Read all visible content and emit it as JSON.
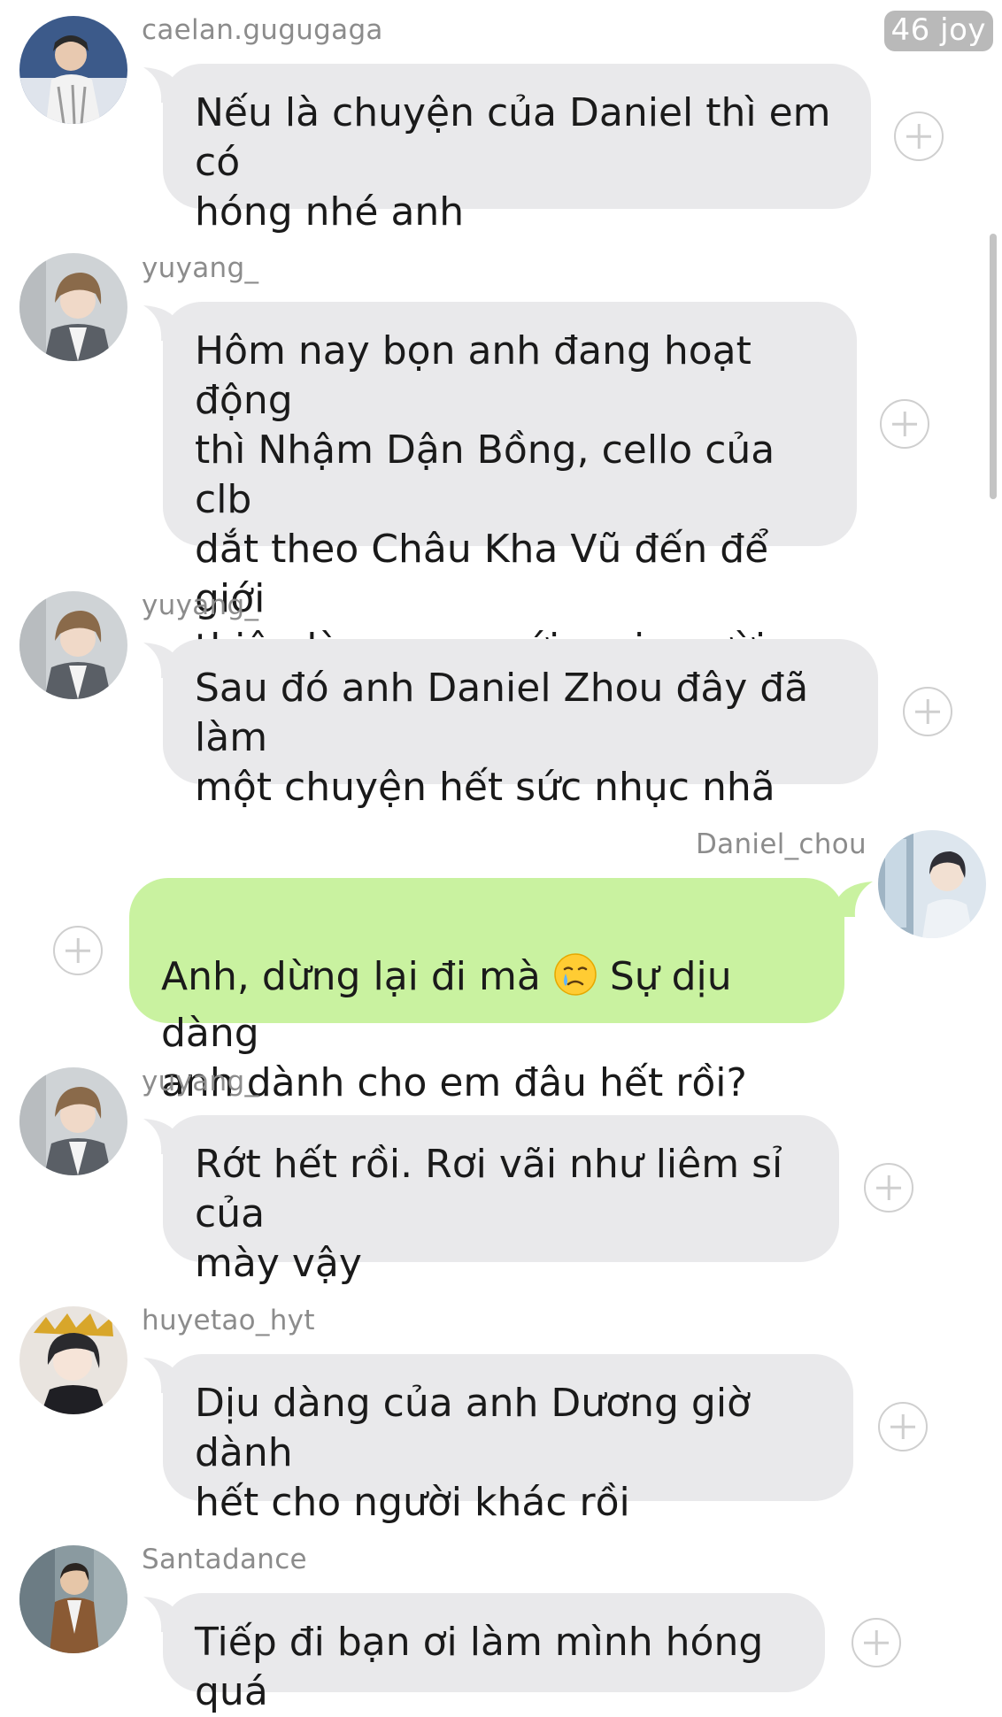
{
  "watermark": "46 joy",
  "messages": [
    {
      "sender": "caelan.gugugaga",
      "text": "Nếu là chuyện của Daniel thì em có\nhóng nhé anh",
      "avatar": "user-avatar-caelan"
    },
    {
      "sender": "yuyang_",
      "text": "Hôm nay bọn anh đang hoạt động\nthì Nhậm Dận Bồng, cello của clb\ndắt theo Châu Kha Vũ đến để giới\nthiệu làm quen với mọi người",
      "avatar": "user-avatar-yuyang"
    },
    {
      "sender": "yuyang_",
      "text": "Sau đó anh Daniel Zhou đây đã làm\nmột chuyện hết sức nhục nhã",
      "avatar": "user-avatar-yuyang"
    },
    {
      "sender": "Daniel_chou",
      "text_before_emoji": "Anh, dừng lại đi mà ",
      "emoji": "crying-face-emoji",
      "text_after_emoji": " Sự dịu dàng\nanh dành cho em đâu hết rồi?",
      "avatar": "user-avatar-daniel",
      "mine": true
    },
    {
      "sender": "yuyang_",
      "text": "Rớt hết rồi. Rơi vãi như liêm sỉ của\nmày vậy",
      "avatar": "user-avatar-yuyang"
    },
    {
      "sender": "huyetao_hyt",
      "text": "Dịu dàng của anh Dương giờ dành\nhết cho người khác rồi",
      "avatar": "user-avatar-huyetao"
    },
    {
      "sender": "Santadance",
      "text": "Tiếp đi bạn ơi làm mình hóng quá",
      "avatar": "user-avatar-santadance"
    }
  ],
  "colors": {
    "incoming_bubble": "#e9e9eb",
    "outgoing_bubble": "#c9f2a0",
    "username": "#8c8c8c",
    "plus_icon": "#cfcfcf"
  }
}
